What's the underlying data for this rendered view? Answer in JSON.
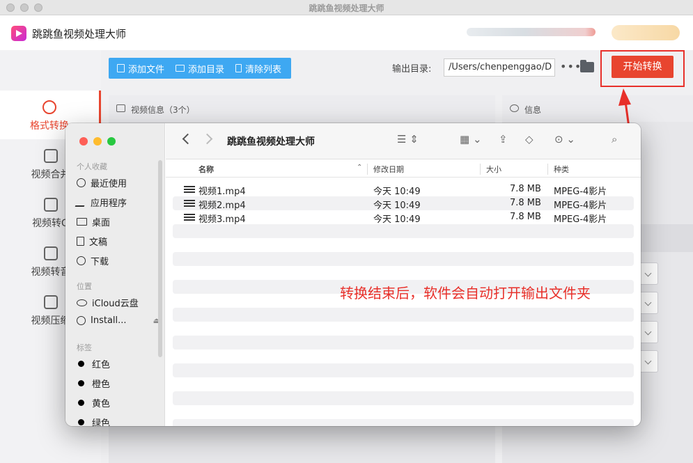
{
  "window": {
    "title": "跳跳鱼视频处理大师"
  },
  "app": {
    "name": "跳跳鱼视频处理大师",
    "colors": {
      "accent": "#e8452f",
      "toolbar": "#3ea8f2",
      "highlight": "#e8302a"
    }
  },
  "sidebar": {
    "items": [
      {
        "label": "格式转换",
        "icon": "convert-icon",
        "active": true
      },
      {
        "label": "视频合并",
        "icon": "merge-icon"
      },
      {
        "label": "视频转G",
        "icon": "gif-icon"
      },
      {
        "label": "视频转音",
        "icon": "audio-icon"
      },
      {
        "label": "视频压缩",
        "icon": "compress-icon"
      }
    ]
  },
  "toolbar": {
    "add_file": "添加文件",
    "add_dir": "添加目录",
    "clear_list": "清除列表",
    "output_label": "输出目录:",
    "output_path": "/Users/chenpenggao/D",
    "more": "•••",
    "start": "开始转换"
  },
  "panels": {
    "video_info": "视频信息（3个）",
    "info": "信息"
  },
  "finder": {
    "title": "跳跳鱼视频处理大师",
    "sections": {
      "favorites": "个人收藏",
      "locations": "位置",
      "tags": "标签"
    },
    "favorites": [
      {
        "label": "最近使用",
        "icon": "clock-icon"
      },
      {
        "label": "应用程序",
        "icon": "apps-icon"
      },
      {
        "label": "桌面",
        "icon": "desktop-icon"
      },
      {
        "label": "文稿",
        "icon": "document-icon"
      },
      {
        "label": "下载",
        "icon": "download-icon"
      }
    ],
    "locations": [
      {
        "label": "iCloud云盘",
        "icon": "cloud-icon"
      },
      {
        "label": "Install...",
        "icon": "disk-icon"
      }
    ],
    "tags": [
      {
        "label": "红色",
        "color": "#000000"
      },
      {
        "label": "橙色",
        "color": "#000000"
      },
      {
        "label": "黄色",
        "color": "#000000"
      },
      {
        "label": "绿色",
        "color": "#000000"
      }
    ],
    "columns": {
      "name": "名称",
      "date": "修改日期",
      "size": "大小",
      "kind": "种类"
    },
    "files": [
      {
        "name": "视频1.mp4",
        "date": "今天 10:49",
        "size": "7.8 MB",
        "kind": "MPEG-4影片"
      },
      {
        "name": "视频2.mp4",
        "date": "今天 10:49",
        "size": "7.8 MB",
        "kind": "MPEG-4影片"
      },
      {
        "name": "视频3.mp4",
        "date": "今天 10:49",
        "size": "7.8 MB",
        "kind": "MPEG-4影片"
      }
    ],
    "notice": "转换结束后，软件会自动打开输出文件夹"
  }
}
